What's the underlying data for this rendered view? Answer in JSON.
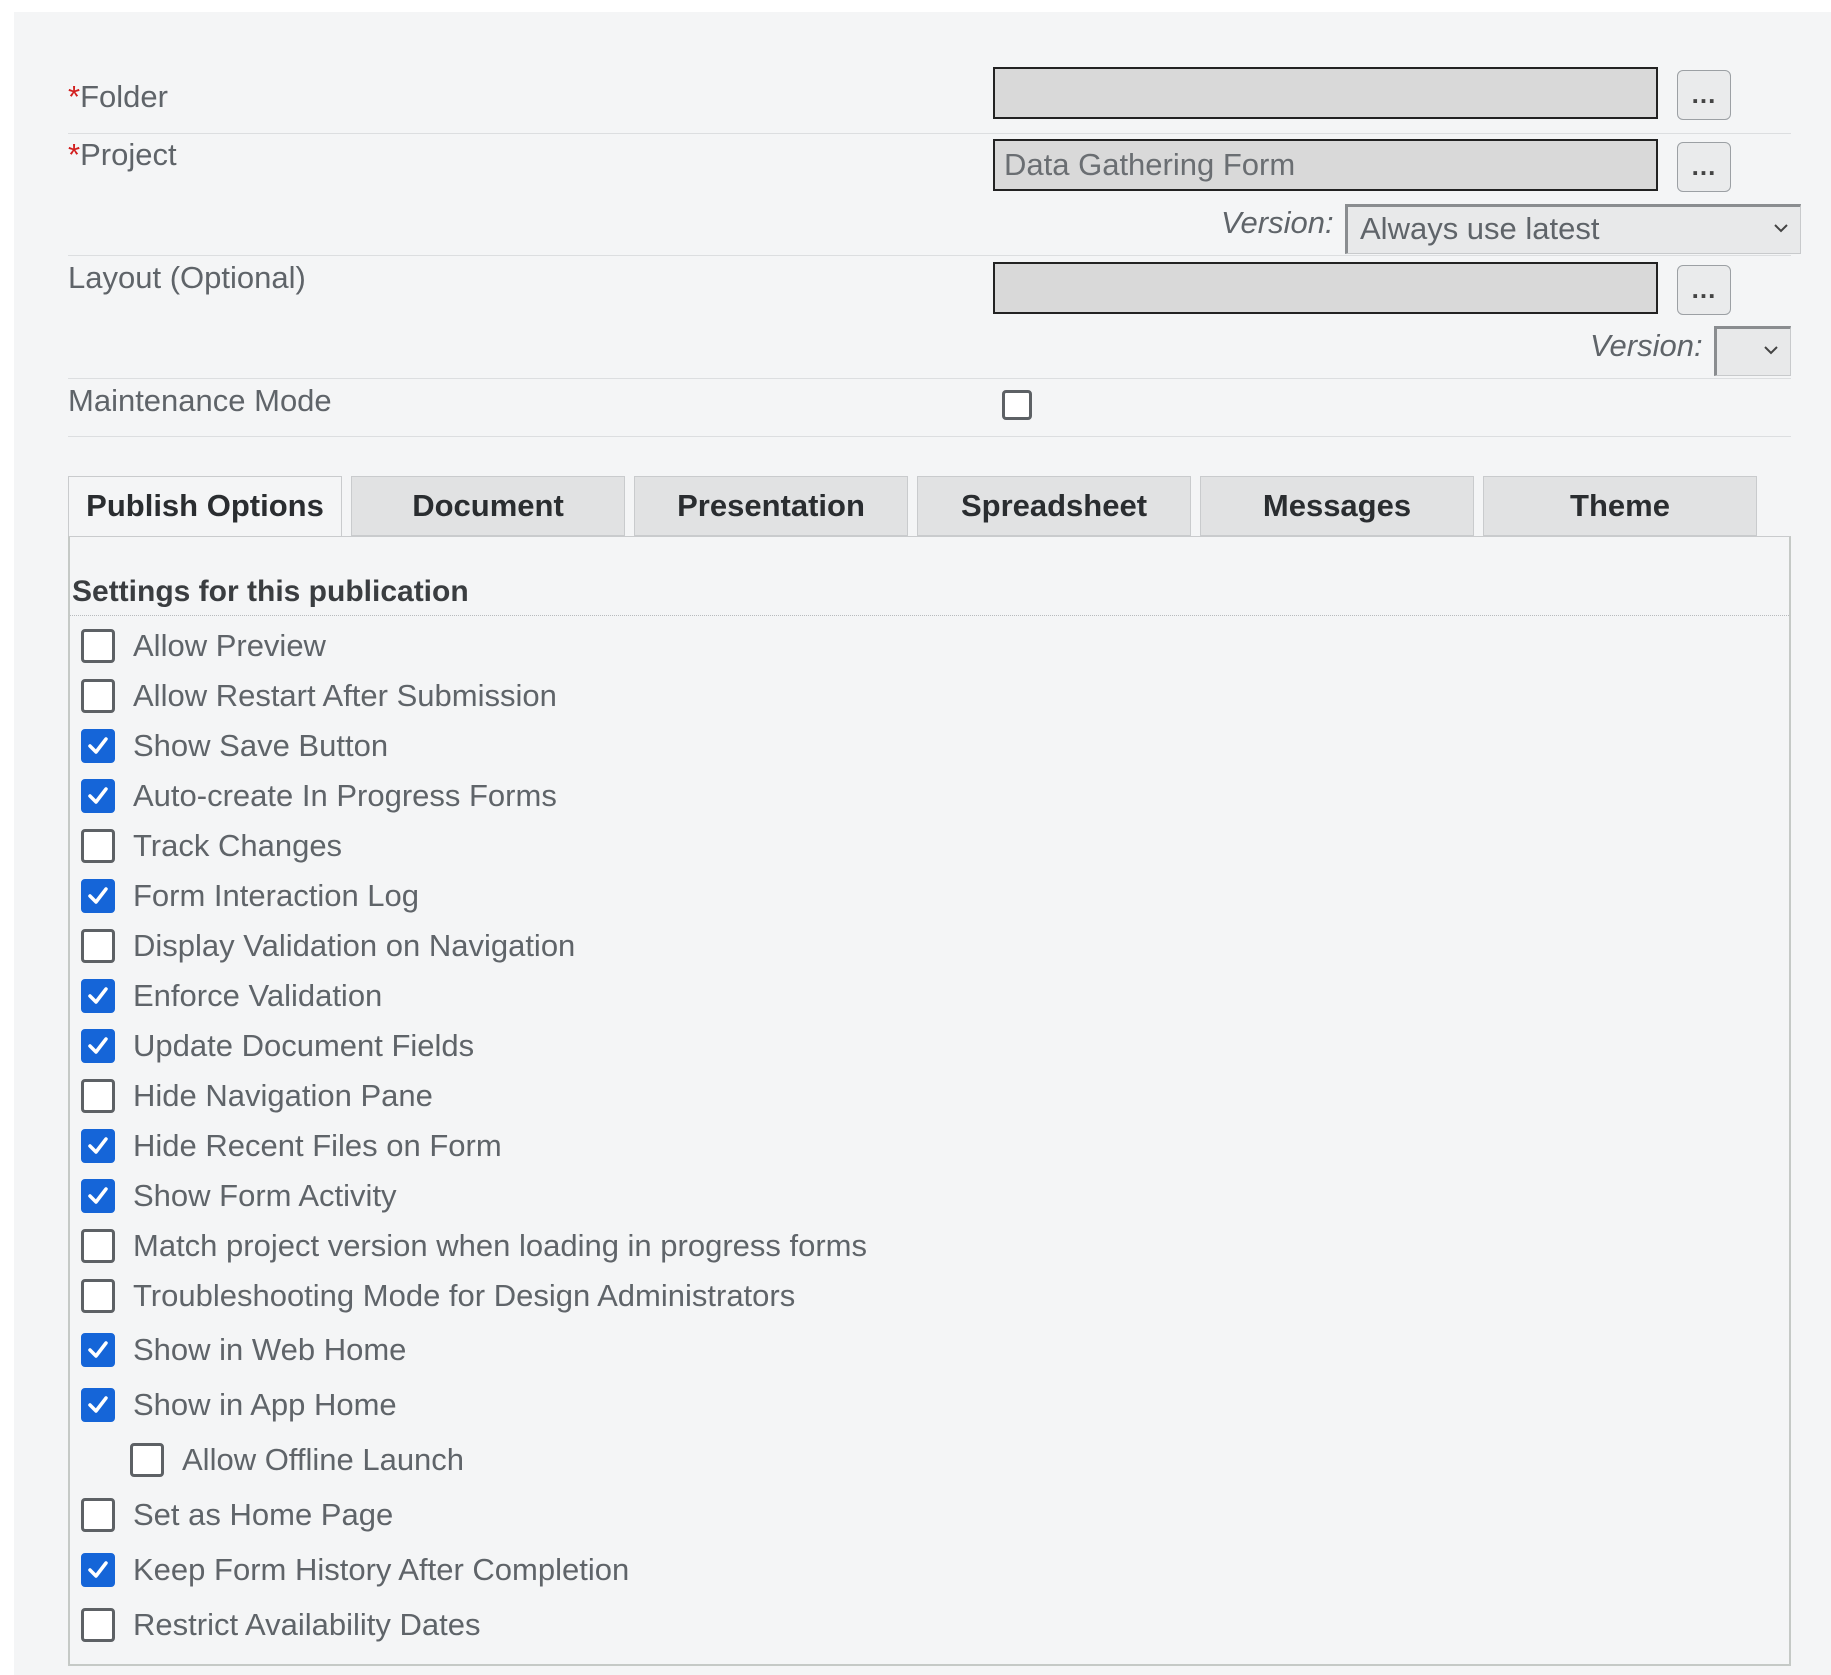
{
  "form": {
    "folder": {
      "required_mark": "*",
      "label": "Folder",
      "value": "",
      "browse_label": "..."
    },
    "project": {
      "required_mark": "*",
      "label": "Project",
      "value": "Data Gathering Form",
      "browse_label": "...",
      "version_label": "Version:",
      "version_value": "Always use latest"
    },
    "layout": {
      "label": "Layout (Optional)",
      "value": "",
      "browse_label": "...",
      "version_label": "Version:",
      "version_value": ""
    },
    "maintenance": {
      "label": "Maintenance Mode",
      "checked": false
    }
  },
  "tabs": [
    {
      "label": "Publish Options",
      "active": true
    },
    {
      "label": "Document",
      "active": false
    },
    {
      "label": "Presentation",
      "active": false
    },
    {
      "label": "Spreadsheet",
      "active": false
    },
    {
      "label": "Messages",
      "active": false
    },
    {
      "label": "Theme",
      "active": false
    }
  ],
  "panel": {
    "title": "Settings for this publication",
    "options": [
      {
        "label": "Allow Preview",
        "checked": false
      },
      {
        "label": "Allow Restart After Submission",
        "checked": false
      },
      {
        "label": "Show Save Button",
        "checked": true
      },
      {
        "label": "Auto-create In Progress Forms",
        "checked": true
      },
      {
        "label": "Track Changes",
        "checked": false
      },
      {
        "label": "Form Interaction Log",
        "checked": true
      },
      {
        "label": "Display Validation on Navigation",
        "checked": false
      },
      {
        "label": "Enforce Validation",
        "checked": true
      },
      {
        "label": "Update Document Fields",
        "checked": true
      },
      {
        "label": "Hide Navigation Pane",
        "checked": false
      },
      {
        "label": "Hide Recent Files on Form",
        "checked": true
      },
      {
        "label": "Show Form Activity",
        "checked": true
      },
      {
        "label": "Match project version when loading in progress forms",
        "checked": false
      },
      {
        "label": "Troubleshooting Mode for Design Administrators",
        "checked": false
      },
      {
        "label": "Show in Web Home",
        "checked": true
      },
      {
        "label": "Show in App Home",
        "checked": true
      },
      {
        "label": "Allow Offline Launch",
        "checked": false,
        "indent": true
      },
      {
        "label": "Set as Home Page",
        "checked": false
      },
      {
        "label": "Keep Form History After Completion",
        "checked": true
      },
      {
        "label": "Restrict Availability Dates",
        "checked": false
      }
    ]
  },
  "colors": {
    "required": "#d21e1e",
    "checkbox_checked": "#1565d8",
    "field_bg": "#d9d9d9",
    "page_bg": "#f4f5f6"
  },
  "icons": {
    "check": "checkmark-icon",
    "dropdown": "chevron-down-icon"
  }
}
